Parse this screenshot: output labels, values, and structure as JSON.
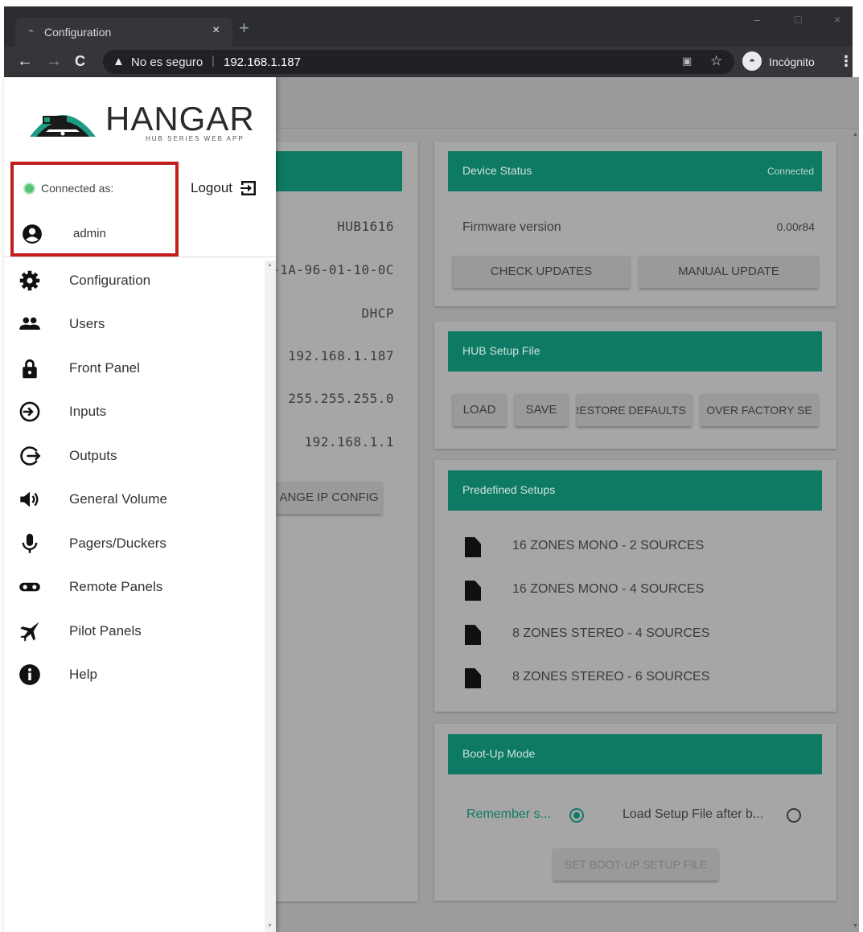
{
  "browser": {
    "tab_title": "Configuration",
    "tab_close": "×",
    "new_tab": "+",
    "back": "←",
    "forward": "→",
    "reload": "C",
    "security_warning_icon": "▲",
    "security_text": "No es seguro",
    "separator": "|",
    "url": "192.168.1.187",
    "incognito_label": "Incógnito",
    "window_minimize": "–",
    "window_maximize": "□",
    "window_close": "×"
  },
  "drawer": {
    "logo_text": "HANGAR",
    "logo_tagline": "HUB SERIES WEB APP",
    "connected_label": "Connected as:",
    "logout_label": "Logout",
    "username": "admin",
    "nav_items": [
      {
        "label": "Configuration",
        "icon": "gear-icon"
      },
      {
        "label": "Users",
        "icon": "users-icon"
      },
      {
        "label": "Front Panel",
        "icon": "lock-icon"
      },
      {
        "label": "Inputs",
        "icon": "input-icon"
      },
      {
        "label": "Outputs",
        "icon": "output-icon"
      },
      {
        "label": "General Volume",
        "icon": "volume-icon"
      },
      {
        "label": "Pagers/Duckers",
        "icon": "microphone-icon"
      },
      {
        "label": "Remote Panels",
        "icon": "remote-panel-icon"
      },
      {
        "label": "Pilot Panels",
        "icon": "jet-icon"
      },
      {
        "label": "Help",
        "icon": "info-icon"
      }
    ]
  },
  "network_card": {
    "values": [
      "HUB1616",
      "-1A-96-01-10-0C",
      "DHCP",
      "192.168.1.187",
      "255.255.255.0",
      "192.168.1.1"
    ],
    "change_ip_button": "ANGE IP CONFIG"
  },
  "device_status": {
    "title": "Device Status",
    "status": "Connected",
    "firmware_label": "Firmware version",
    "firmware_value": "0.00r84",
    "check_updates": "CHECK UPDATES",
    "manual_update": "MANUAL UPDATE"
  },
  "hub_setup": {
    "title": "HUB Setup File",
    "load": "LOAD",
    "save": "SAVE",
    "restore": "RESTORE DEFAULTS",
    "recover": "OVER FACTORY SE"
  },
  "predefined": {
    "title": "Predefined Setups",
    "items": [
      "16 ZONES MONO - 2 SOURCES",
      "16 ZONES MONO - 4 SOURCES",
      "8 ZONES STEREO - 4 SOURCES",
      "8 ZONES STEREO - 6 SOURCES"
    ]
  },
  "bootup": {
    "title": "Boot-Up Mode",
    "option_remember": "Remember s...",
    "option_load": "Load Setup File after b...",
    "selected": "remember",
    "set_button": "SET BOOT-UP SETUP FILE"
  },
  "colors": {
    "accent": "#0f7a63",
    "highlight_border": "#c11d1d",
    "connected_dot": "#56c474"
  }
}
